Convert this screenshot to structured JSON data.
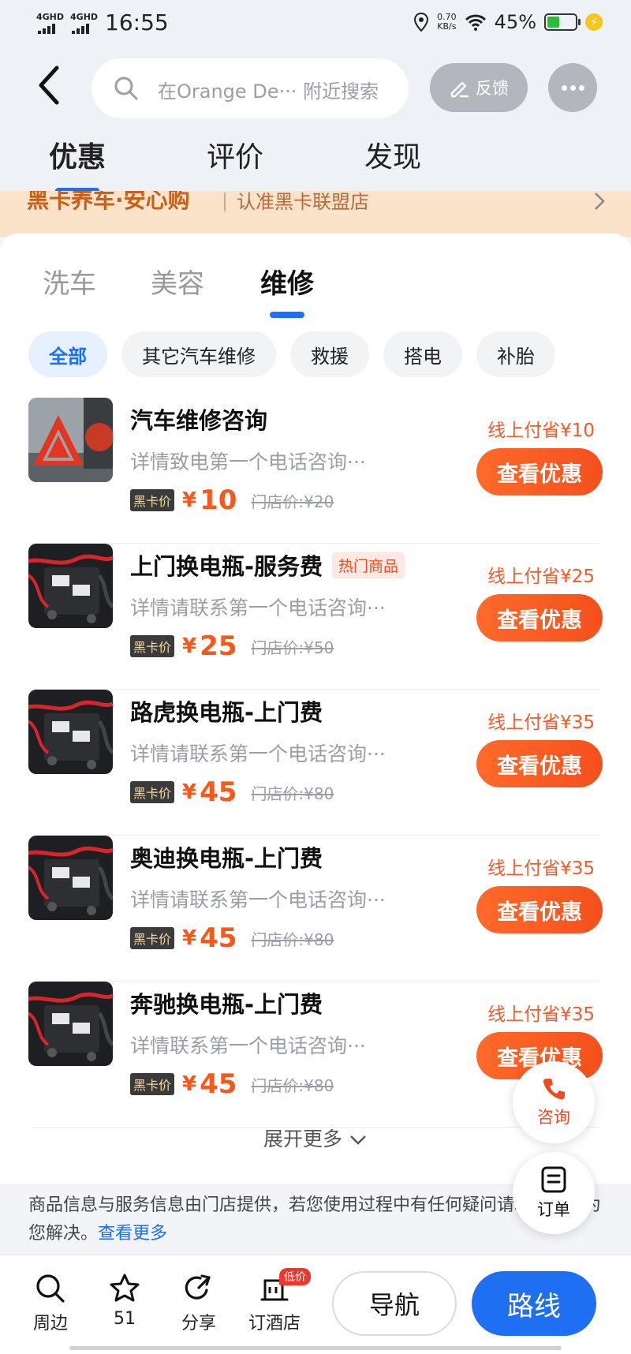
{
  "status_bar": {
    "net1": "4GHD",
    "net2": "4GHD",
    "time": "16:55",
    "speed_value": "0.70",
    "speed_unit": "KB/s",
    "battery_pct": "45%",
    "battery_level": 0.45
  },
  "header": {
    "search_placeholder": "在Orange De··· 附近搜索",
    "feedback_label": "反馈",
    "tabs": [
      {
        "label": "优惠",
        "active": true
      },
      {
        "label": "评价",
        "active": false
      },
      {
        "label": "发现",
        "active": false
      }
    ]
  },
  "banner": {
    "title": "黑卡养车·安心购",
    "subtitle": "认准黑卡联盟店"
  },
  "sub_tabs": [
    {
      "label": "洗车",
      "active": false
    },
    {
      "label": "美容",
      "active": false
    },
    {
      "label": "维修",
      "active": true
    }
  ],
  "filters": [
    {
      "label": "全部",
      "active": true
    },
    {
      "label": "其它汽车维修",
      "active": false
    },
    {
      "label": "救援",
      "active": false
    },
    {
      "label": "搭电",
      "active": false
    },
    {
      "label": "补胎",
      "active": false
    }
  ],
  "items": [
    {
      "title": "汽车维修咨询",
      "tag": "",
      "desc": "详情致电第一个电话咨询···",
      "black_card_label": "黑卡价",
      "currency": "¥",
      "price": "10",
      "original": "门店价:¥20",
      "save": "线上付省¥10",
      "cta": "查看优惠",
      "image": "warning-triangle"
    },
    {
      "title": "上门换电瓶-服务费",
      "tag": "热门商品",
      "desc": "详情请联系第一个电话咨询···",
      "black_card_label": "黑卡价",
      "currency": "¥",
      "price": "25",
      "original": "门店价:¥50",
      "save": "线上付省¥25",
      "cta": "查看优惠",
      "image": "battery-cables"
    },
    {
      "title": "路虎换电瓶-上门费",
      "tag": "",
      "desc": "详情请联系第一个电话咨询···",
      "black_card_label": "黑卡价",
      "currency": "¥",
      "price": "45",
      "original": "门店价:¥80",
      "save": "线上付省¥35",
      "cta": "查看优惠",
      "image": "battery-cables"
    },
    {
      "title": "奥迪换电瓶-上门费",
      "tag": "",
      "desc": "详情请联系第一个电话咨询···",
      "black_card_label": "黑卡价",
      "currency": "¥",
      "price": "45",
      "original": "门店价:¥80",
      "save": "线上付省¥35",
      "cta": "查看优惠",
      "image": "battery-cables"
    },
    {
      "title": "奔驰换电瓶-上门费",
      "tag": "",
      "desc": "详情联系第一个电话咨询···",
      "black_card_label": "黑卡价",
      "currency": "¥",
      "price": "45",
      "original": "门店价:¥80",
      "save": "线上付省¥35",
      "cta": "查看优惠",
      "image": "battery-cables"
    }
  ],
  "expand_label": "展开更多",
  "notice": {
    "text": "商品信息与服务信息由门店提供，若您使用过程中有任何疑问请联系高德为您解决。",
    "link": "查看更多"
  },
  "floating": {
    "consult_label": "咨询",
    "order_label": "订单"
  },
  "bottom_bar": {
    "nearby_label": "周边",
    "favorite_count": "51",
    "share_label": "分享",
    "hotel_label": "订酒店",
    "hotel_badge": "低价",
    "navigate_label": "导航",
    "route_label": "路线"
  },
  "colors": {
    "accent_blue": "#1f6ff2",
    "price_orange": "#f8591b",
    "cta_orange": "#f5501c"
  }
}
